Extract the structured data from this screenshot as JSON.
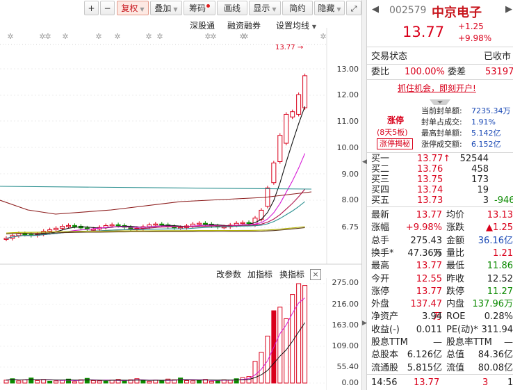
{
  "toolbar": {
    "plus": "+",
    "minus": "−",
    "fuquan": "复权",
    "diejia": "叠加",
    "chouma": "筹码",
    "huaxian": "画线",
    "xianshi": "显示",
    "jianyue": "简约",
    "yincang": "隐藏"
  },
  "sublinks": {
    "shengutong": "深股通",
    "rongzi": "融资融券",
    "setma": "设置均线"
  },
  "price_axis": [
    "13.00",
    "12.00",
    "11.00",
    "10.00",
    "9.00",
    "8.00",
    "6.75"
  ],
  "price_marker": "13.77",
  "volume": {
    "links": {
      "params": "改参数",
      "add": "加指标",
      "switch": "换指标"
    },
    "close": "×",
    "axis": [
      "275.00",
      "216.00",
      "163.00",
      "109.00",
      "55.40",
      "0.00"
    ]
  },
  "quote": {
    "code": "002579",
    "name": "中京电子",
    "price": "13.77",
    "change": "+1.25",
    "change_pct": "+9.98%",
    "trade_state_label": "交易状态",
    "trade_state_value": "已收市",
    "weibi_label": "委比",
    "weibi_value": "100.00%",
    "weicha_label": "委差",
    "weicha_value": "53197",
    "promo": "抓住机会，即刻开户!",
    "limit_up": "涨停",
    "limit_streak": "(8天5板)",
    "limit_reveal": "涨停揭秘",
    "seal_rows": [
      {
        "label": "当前封单额:",
        "value": "7235.34万"
      },
      {
        "label": "封单占成交:",
        "value": "1.91%"
      },
      {
        "label": "最高封单额:",
        "value": "5.142亿"
      },
      {
        "label": "涨停成交额:",
        "value": "6.152亿"
      }
    ],
    "order_book": [
      {
        "label": "买一",
        "price": "13.77↑",
        "vol": "52544",
        "extra": ""
      },
      {
        "label": "买二",
        "price": "13.76",
        "vol": "458",
        "extra": ""
      },
      {
        "label": "买三",
        "price": "13.75",
        "vol": "173",
        "extra": ""
      },
      {
        "label": "买四",
        "price": "13.74",
        "vol": "19",
        "extra": ""
      },
      {
        "label": "买五",
        "price": "13.73",
        "vol": "3",
        "extra": "-946"
      }
    ],
    "stats": [
      {
        "l1": "最新",
        "v1": "13.77",
        "c1": "red",
        "l2": "均价",
        "v2": "13.13",
        "c2": "red"
      },
      {
        "l1": "涨幅",
        "v1": "+9.98%",
        "c1": "red",
        "l2": "涨跌",
        "v2": "▲1.25",
        "c2": "red"
      },
      {
        "l1": "总手",
        "v1": "275.43万",
        "c1": "blk",
        "l2": "金额",
        "v2": "36.16亿",
        "c2": "blue"
      },
      {
        "l1": "换手*",
        "v1": "47.36%",
        "c1": "blk",
        "l2": "量比",
        "v2": "1.21",
        "c2": "red"
      },
      {
        "l1": "最高",
        "v1": "13.77",
        "c1": "red",
        "l2": "最低",
        "v2": "11.86",
        "c2": "green"
      },
      {
        "l1": "今开",
        "v1": "12.55",
        "c1": "red",
        "l2": "昨收",
        "v2": "12.52",
        "c2": "blk"
      },
      {
        "l1": "涨停",
        "v1": "13.77",
        "c1": "red",
        "l2": "跌停",
        "v2": "11.27",
        "c2": "green"
      },
      {
        "l1": "外盘",
        "v1": "137.47万",
        "c1": "red",
        "l2": "内盘",
        "v2": "137.96万",
        "c2": "green"
      },
      {
        "l1": "净资产",
        "v1": "3.94",
        "c1": "blk",
        "l2": "ROE",
        "v2": "0.28%",
        "c2": "blk"
      },
      {
        "l1": "收益(-)",
        "v1": "0.011",
        "c1": "blk",
        "l2": "PE(动)*",
        "v2": "311.94",
        "c2": "blk"
      },
      {
        "l1": "股息TTM",
        "v1": "—",
        "c1": "blk",
        "l2": "股息率TTM",
        "v2": "—",
        "c2": "blk"
      },
      {
        "l1": "总股本",
        "v1": "6.126亿",
        "c1": "blk",
        "l2": "总值",
        "v2": "84.36亿",
        "c2": "blk"
      },
      {
        "l1": "流通股",
        "v1": "5.815亿",
        "c1": "blk",
        "l2": "流值",
        "v2": "80.08亿",
        "c2": "blk"
      }
    ],
    "tick": {
      "time": "14:56",
      "price": "13.77",
      "vol": "3",
      "n": "1"
    }
  },
  "colors": {
    "up": "#d9001b",
    "down": "#0b8a00",
    "blue": "#1a49b5"
  }
}
